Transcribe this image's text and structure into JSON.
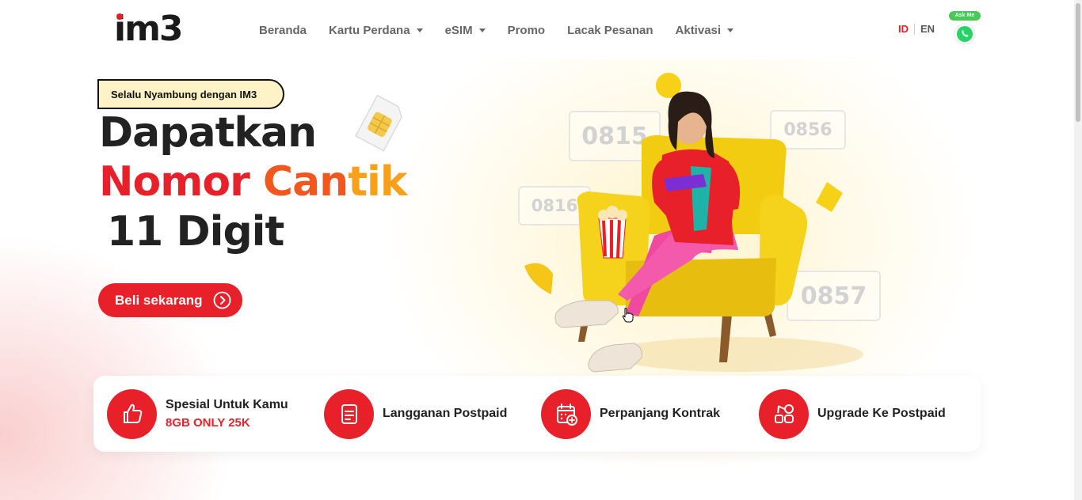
{
  "brand": {
    "logo_text": "im3",
    "accent": "#e8202a",
    "dark": "#222222"
  },
  "nav": {
    "items": [
      {
        "label": "Beranda",
        "dropdown": false
      },
      {
        "label": "Kartu Perdana",
        "dropdown": true
      },
      {
        "label": "eSIM",
        "dropdown": true
      },
      {
        "label": "Promo",
        "dropdown": false
      },
      {
        "label": "Lacak Pesanan",
        "dropdown": false
      },
      {
        "label": "Aktivasi",
        "dropdown": true
      }
    ],
    "lang_id": "ID",
    "lang_en": "EN",
    "whatsapp_badge": "Ask Me"
  },
  "hero": {
    "tagline": "Selalu Nyambung dengan IM3",
    "headline_line1": "Dapatkan",
    "headline_line2_a": "Nomor ",
    "headline_line2_b": "Can",
    "headline_line2_c": "tik",
    "headline_line3": "11 Digit",
    "cta_label": "Beli sekarang",
    "numbers": [
      "0815",
      "0856",
      "0816",
      "0857"
    ]
  },
  "quick_menu": [
    {
      "label": "Spesial Untuk Kamu",
      "sub": "8GB ONLY 25K",
      "icon": "thumbs-up-icon"
    },
    {
      "label": "Langganan Postpaid",
      "sub": "",
      "icon": "document-icon"
    },
    {
      "label": "Perpanjang Kontrak",
      "sub": "",
      "icon": "calendar-plus-icon"
    },
    {
      "label": "Upgrade Ke Postpaid",
      "sub": "",
      "icon": "shapes-icon"
    }
  ]
}
